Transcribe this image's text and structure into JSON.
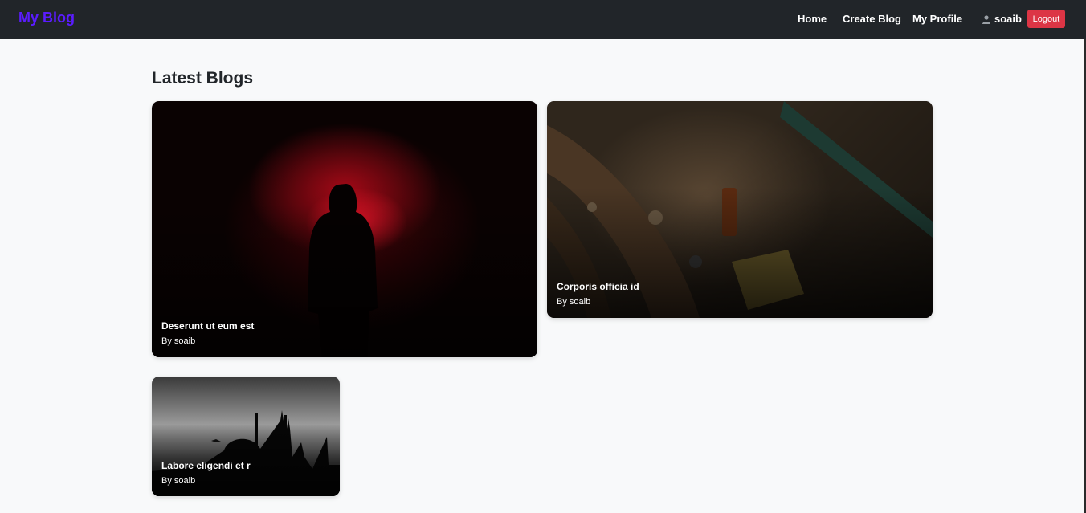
{
  "navbar": {
    "brand": "My Blog",
    "links": [
      "Home",
      "Create Blog",
      "My Profile"
    ],
    "username": "soaib",
    "logout_label": "Logout"
  },
  "page": {
    "heading": "Latest Blogs"
  },
  "blogs": [
    {
      "title": "Deserunt ut eum est",
      "author": "By soaib",
      "image": "hooded figure in red smoke"
    },
    {
      "title": "Corporis officia id",
      "author": "By soaib",
      "image": "leather strap and necklace on wood"
    },
    {
      "title": "Labore eligendi et r",
      "author": "By soaib",
      "image": "mosque silhouette at dusk"
    }
  ],
  "colors": {
    "navbar_bg": "#212529",
    "brand": "#5b1cff",
    "logout": "#dc3545",
    "page_bg": "#f8f9fa"
  }
}
